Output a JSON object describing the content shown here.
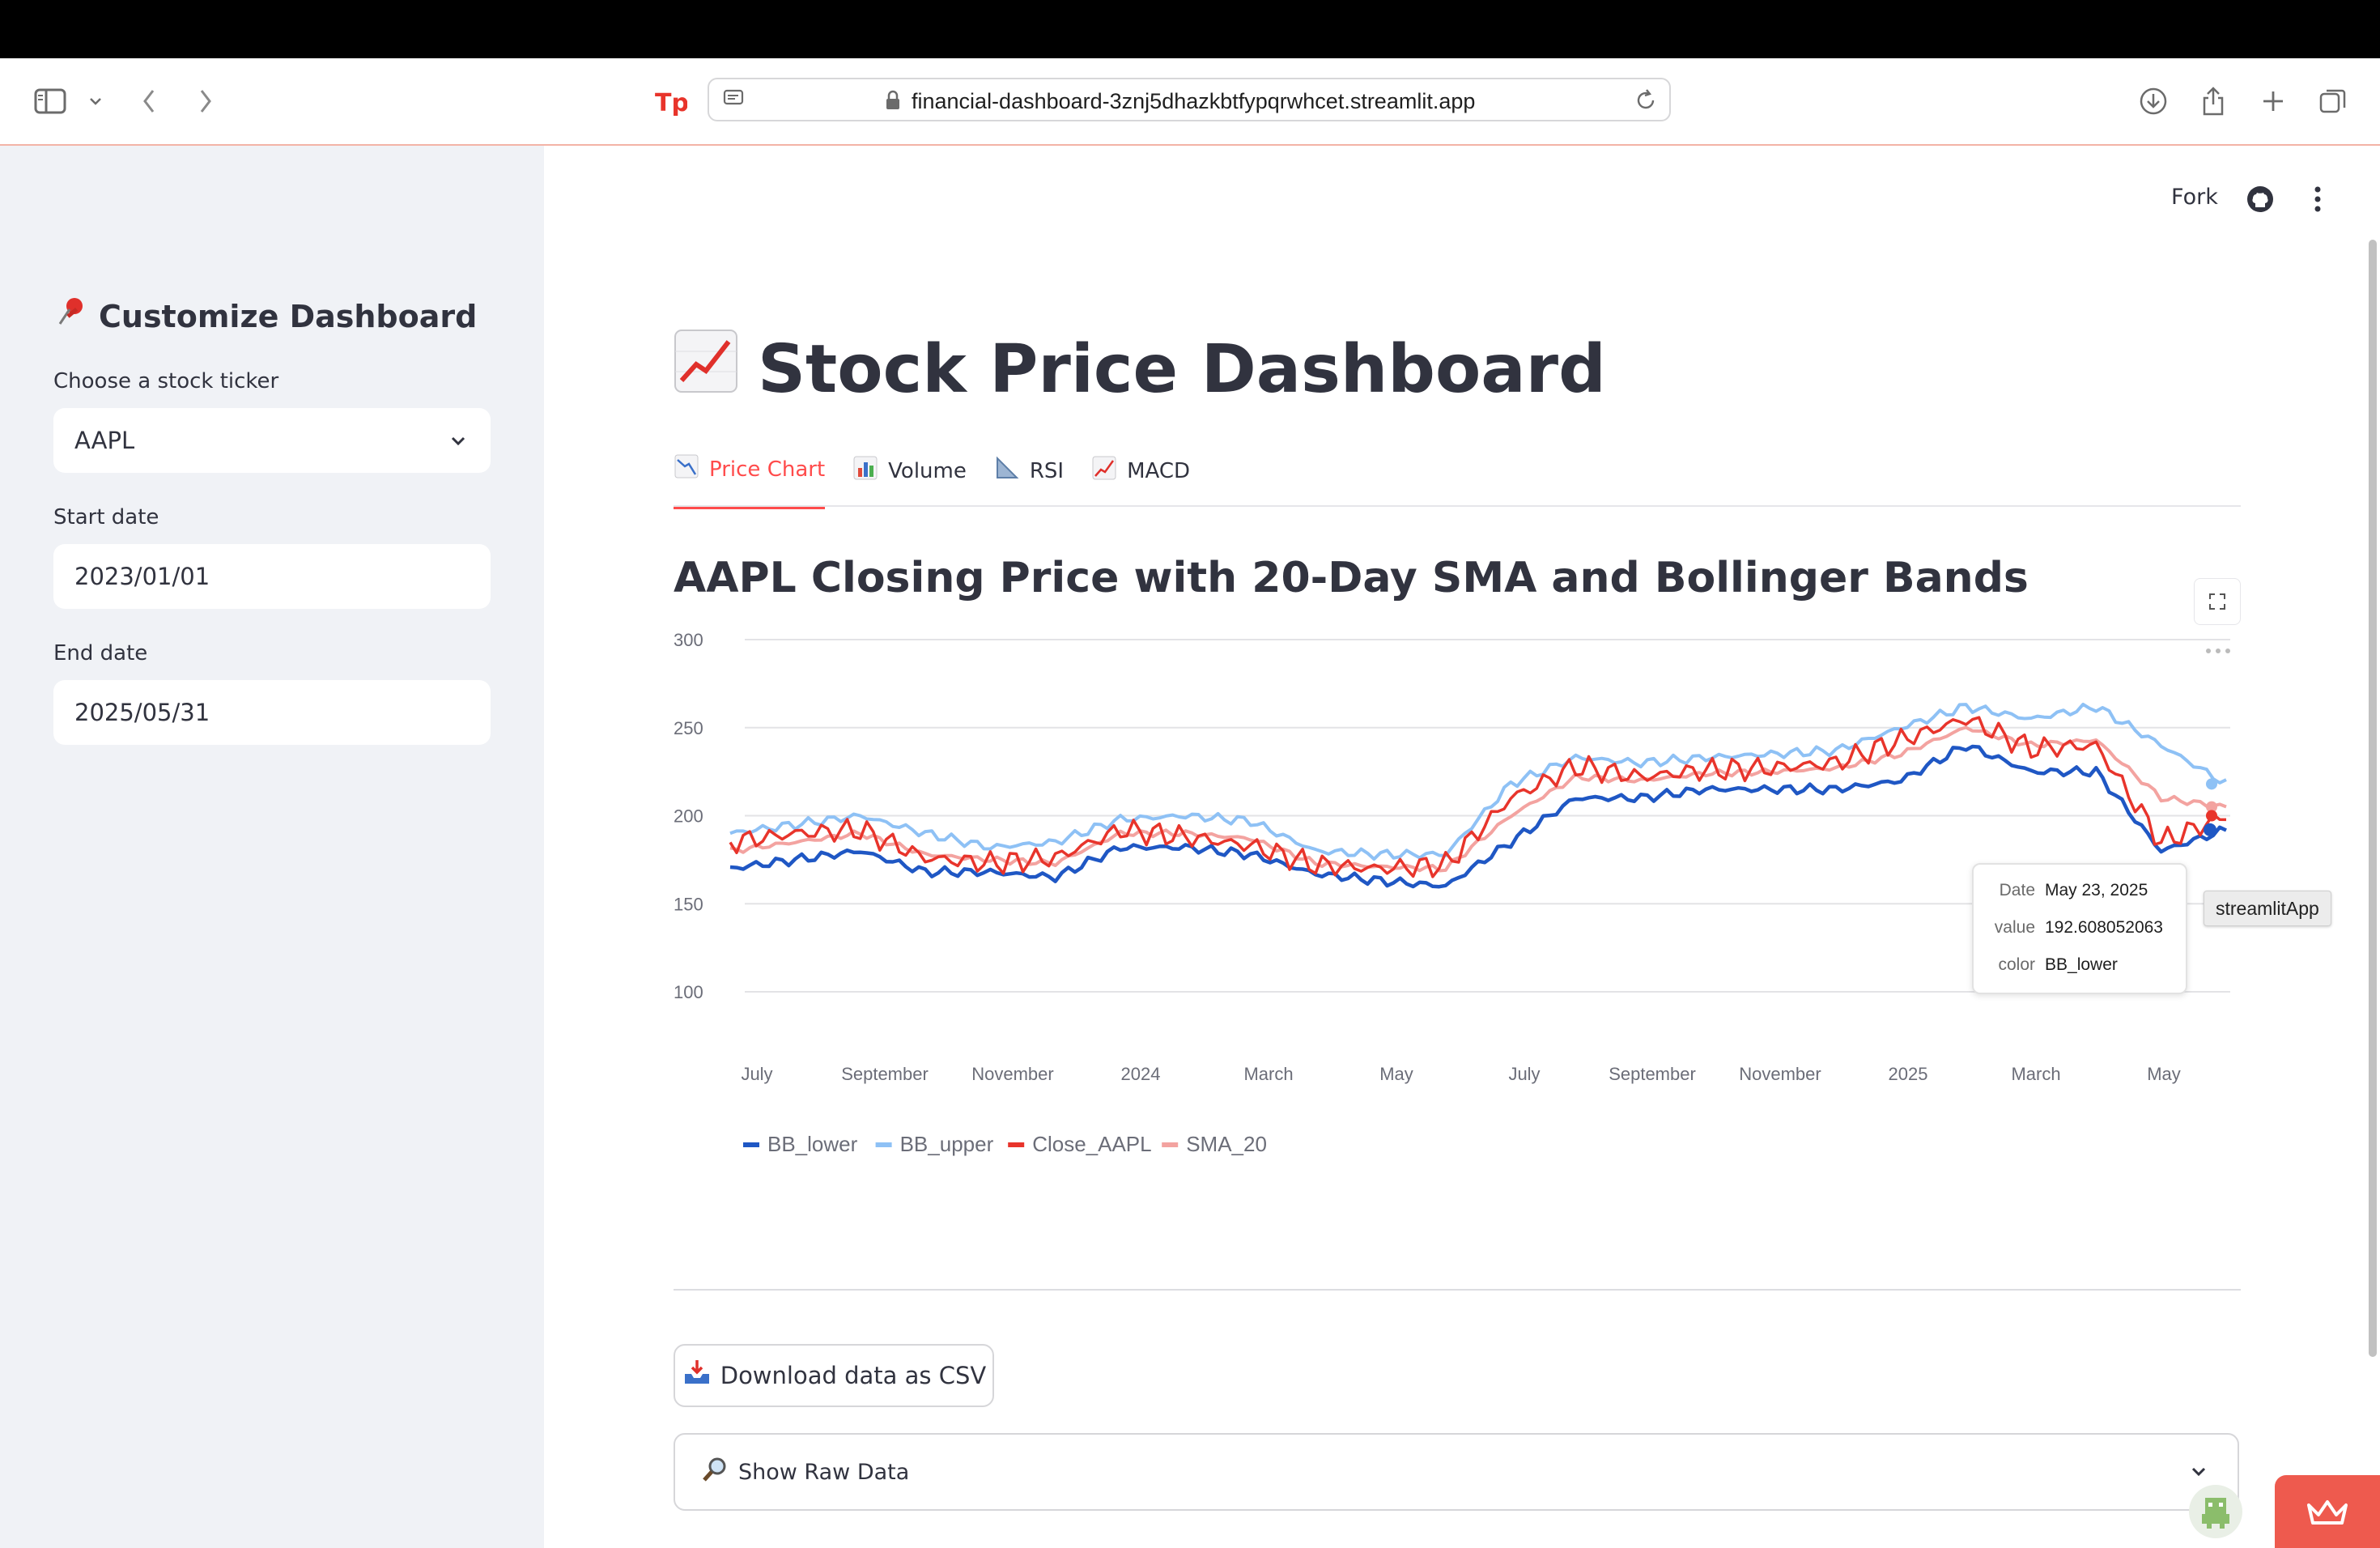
{
  "browser": {
    "url": "financial-dashboard-3znj5dhazkbtfypqrwhcet.streamlit.app"
  },
  "sidebar": {
    "title": "Customize Dashboard",
    "ticker_label": "Choose a stock ticker",
    "ticker_value": "AAPL",
    "start_label": "Start date",
    "start_value": "2023/01/01",
    "end_label": "End date",
    "end_value": "2025/05/31"
  },
  "toolbar": {
    "fork_label": "Fork"
  },
  "page": {
    "title": "Stock Price Dashboard"
  },
  "tabs": [
    {
      "label": "Price Chart",
      "active": true
    },
    {
      "label": "Volume",
      "active": false
    },
    {
      "label": "RSI",
      "active": false
    },
    {
      "label": "MACD",
      "active": false
    }
  ],
  "chart_title": "AAPL Closing Price with 20-Day SMA and Bollinger Bands",
  "chart_data": {
    "type": "line",
    "x_ticks": [
      "July",
      "September",
      "November",
      "2024",
      "March",
      "May",
      "July",
      "September",
      "November",
      "2025",
      "March",
      "May"
    ],
    "y_ticks": [
      100,
      150,
      200,
      250,
      300
    ],
    "ylim": [
      100,
      300
    ],
    "x": [
      "2023-06",
      "2023-07",
      "2023-08",
      "2023-09",
      "2023-10",
      "2023-11",
      "2023-12",
      "2024-01",
      "2024-02",
      "2024-03",
      "2024-04",
      "2024-05",
      "2024-06",
      "2024-07",
      "2024-08",
      "2024-09",
      "2024-10",
      "2024-11",
      "2024-12",
      "2025-01",
      "2025-02",
      "2025-03",
      "2025-04",
      "2025-05"
    ],
    "series": [
      {
        "name": "BB_lower",
        "color": "#1f57c4",
        "values": [
          170,
          175,
          180,
          168,
          168,
          165,
          182,
          182,
          178,
          167,
          163,
          160,
          185,
          210,
          210,
          215,
          215,
          215,
          220,
          240,
          225,
          225,
          180,
          192
        ]
      },
      {
        "name": "BB_upper",
        "color": "#8ec1f5",
        "values": [
          190,
          195,
          200,
          190,
          182,
          185,
          198,
          200,
          197,
          180,
          178,
          178,
          218,
          233,
          230,
          233,
          235,
          237,
          250,
          262,
          255,
          262,
          240,
          218
        ]
      },
      {
        "name": "Close_AAPL",
        "color": "#e8342b",
        "values": [
          185,
          190,
          192,
          176,
          173,
          176,
          192,
          188,
          183,
          172,
          170,
          172,
          210,
          228,
          222,
          226,
          227,
          230,
          243,
          255,
          238,
          240,
          185,
          200
        ]
      },
      {
        "name": "SMA_20",
        "color": "#f3a3a0",
        "values": [
          180,
          185,
          190,
          178,
          175,
          173,
          190,
          190,
          187,
          173,
          171,
          170,
          200,
          222,
          220,
          224,
          225,
          227,
          235,
          250,
          240,
          243,
          210,
          205
        ]
      }
    ],
    "legend_position": "bottom-left"
  },
  "tooltip": {
    "date_key": "Date",
    "date_val": "May 23, 2025",
    "value_key": "value",
    "value_val": "192.608052063",
    "color_key": "color",
    "color_val": "BB_lower"
  },
  "tag_label": "streamlitApp",
  "download_label": "Download data as CSV",
  "expander_label": "Show Raw Data",
  "colors": {
    "accent": "#ff4b4b",
    "sidebar_bg": "#f0f2f6"
  }
}
